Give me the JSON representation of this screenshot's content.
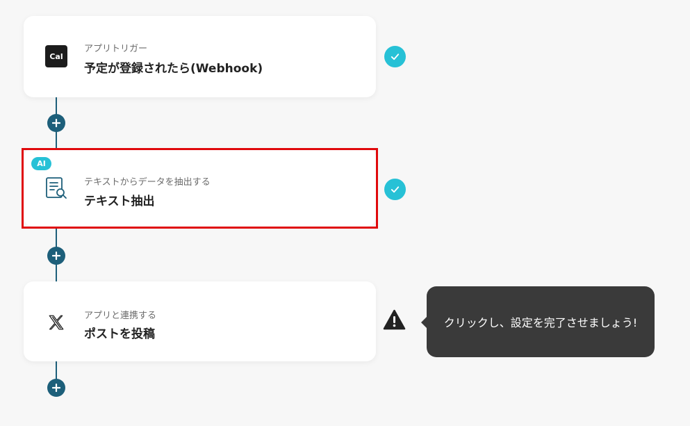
{
  "steps": [
    {
      "badge": "",
      "subtitle": "アプリトリガー",
      "title": "予定が登録されたら(Webhook)",
      "icon": "cal-logo-icon",
      "icon_text": "Cal",
      "status": "complete"
    },
    {
      "badge": "AI",
      "subtitle": "テキストからデータを抽出する",
      "title": "テキスト抽出",
      "icon": "text-extract-icon",
      "status": "complete",
      "highlighted": true
    },
    {
      "badge": "",
      "subtitle": "アプリと連携する",
      "title": "ポストを投稿",
      "icon": "x-logo-icon",
      "status": "warning"
    }
  ],
  "tooltip": {
    "text": "クリックし、設定を完了させましょう!"
  },
  "colors": {
    "accent": "#1d5f7a",
    "check": "#27c1d6",
    "highlight": "#e0090c",
    "tooltip_bg": "#3a3a3a"
  }
}
